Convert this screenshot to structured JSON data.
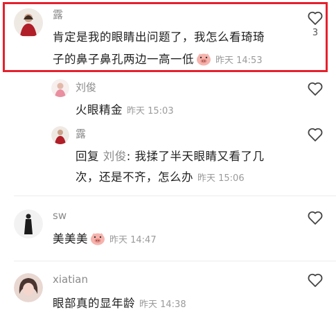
{
  "comments": [
    {
      "username": "露",
      "line1": "肯定是我的眼睛出问题了，我怎么看琦琦",
      "line2": "子的鼻子鼻孔两边一高一低",
      "timestamp": "昨天 14:53",
      "likes": "3",
      "emoji": "pig-face-icon"
    },
    {
      "username": "刘俊",
      "line1": "火眼精金",
      "timestamp": "昨天 15:03"
    },
    {
      "username": "露",
      "reply_prefix": "回复 ",
      "reply_to": "刘俊",
      "line1_rest": ": 我揉了半天眼睛又看了几",
      "line2": "次，还是不齐，怎么办",
      "timestamp": "昨天 15:06"
    },
    {
      "username": "sw",
      "line1": "美美美",
      "timestamp": "昨天 14:47",
      "emoji": "pig-face-icon"
    },
    {
      "username": "xiatian",
      "line1": "眼部真的显年龄",
      "timestamp": "昨天 14:38"
    }
  ],
  "colors": {
    "highlight_border": "#e6202c",
    "username": "#8a8a8a",
    "timestamp": "#9a9a9a"
  }
}
